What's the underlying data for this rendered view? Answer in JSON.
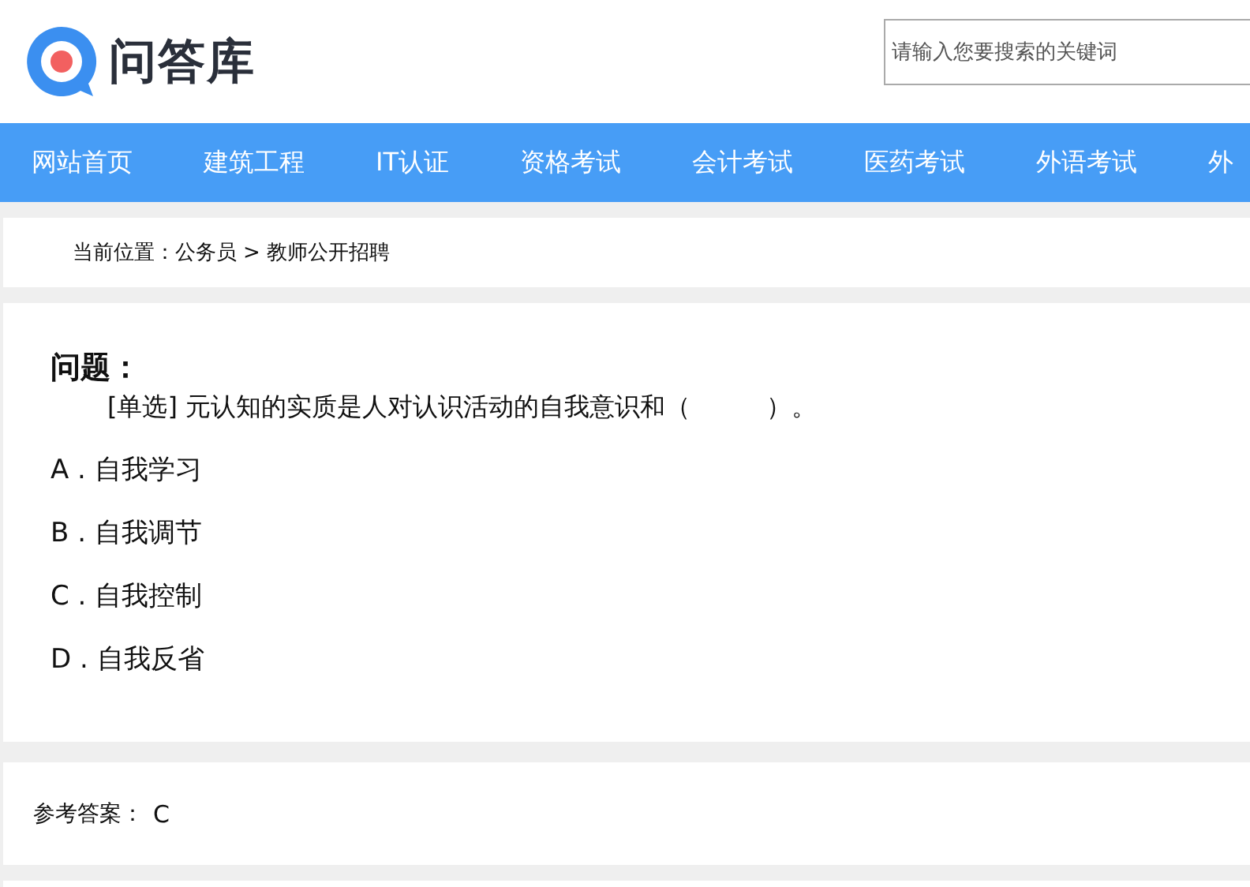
{
  "site": {
    "logo_text": "问答库"
  },
  "search": {
    "placeholder": "请输入您要搜索的关键词"
  },
  "nav": [
    {
      "label": "网站首页"
    },
    {
      "label": "建筑工程"
    },
    {
      "label": "IT认证"
    },
    {
      "label": "资格考试"
    },
    {
      "label": "会计考试"
    },
    {
      "label": "医药考试"
    },
    {
      "label": "外语考试"
    },
    {
      "label": "外"
    }
  ],
  "breadcrumb": {
    "prefix": "当前位置：",
    "items": [
      "公务员",
      "教师公开招聘"
    ],
    "separator": ">"
  },
  "question": {
    "heading": "问题：",
    "stem": "[单选] 元认知的实质是人对认识活动的自我意识和（　　　）。",
    "options": [
      {
        "text": "A . 自我学习"
      },
      {
        "text": "B . 自我调节"
      },
      {
        "text": "C . 自我控制"
      },
      {
        "text": "D . 自我反省"
      }
    ]
  },
  "answer": {
    "label": "参考答案：",
    "value": "C"
  }
}
